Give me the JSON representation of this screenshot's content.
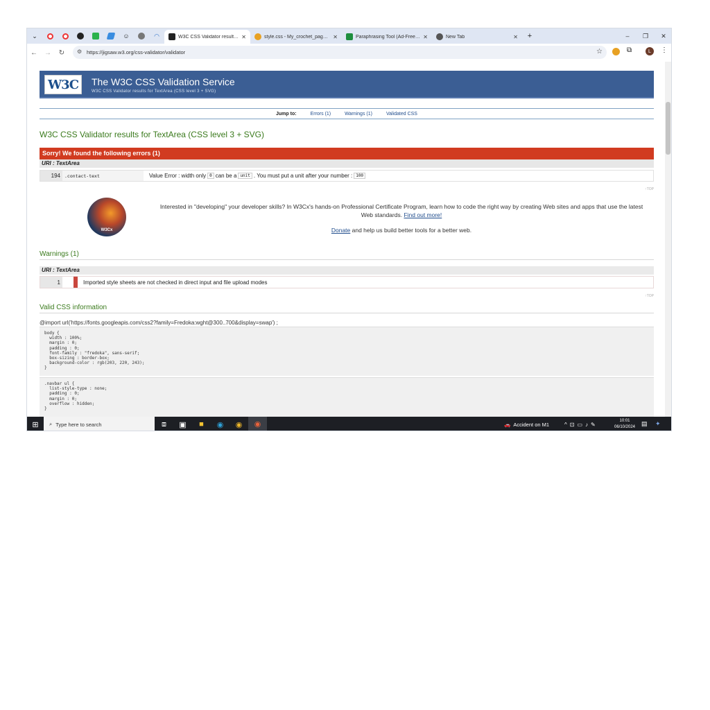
{
  "browser": {
    "tabs": [
      {
        "label": "W3C CSS Validator results for T"
      },
      {
        "label": "style.css - My_crochet_page - G"
      },
      {
        "label": "Paraphrasing Tool (Ad-Free and"
      },
      {
        "label": "New Tab"
      }
    ],
    "url": "https://jigsaw.w3.org/css-validator/validator",
    "avatar_letter": "L"
  },
  "header": {
    "logo_text": "W3C",
    "title": "The W3C CSS Validation Service",
    "subtitle": "W3C CSS Validator results for TextArea (CSS level 3 + SVG)"
  },
  "jump": {
    "label": "Jump to:",
    "errors": "Errors (1)",
    "warnings": "Warnings (1)",
    "validated": "Validated CSS"
  },
  "results_title": "W3C CSS Validator results for TextArea (CSS level 3 + SVG)",
  "errors": {
    "banner": "Sorry! We found the following errors (1)",
    "uri": "URI : TextArea",
    "row": {
      "line": "194",
      "context": ".contact-text",
      "msg_a": "Value Error : width only",
      "code_a": "0",
      "msg_b": "can be a",
      "code_b": "unit",
      "msg_c": ". You must put a unit after your number :",
      "code_c": "100"
    }
  },
  "top_label": "↑TOP",
  "promo": {
    "badge": "W3Cx",
    "text": "Interested in \"developing\" your developer skills? In W3Cx's hands-on Professional Certificate Program, learn how to code the right way by creating Web sites and apps that use the latest Web standards.",
    "link": "Find out more!",
    "donate_link": "Donate",
    "donate_text": " and help us build better tools for a better web."
  },
  "warnings": {
    "heading": "Warnings (1)",
    "uri": "URI : TextArea",
    "row": {
      "line": "1",
      "msg": "Imported style sheets are not checked in direct input and file upload modes"
    }
  },
  "valid": {
    "heading": "Valid CSS information",
    "import": "@import url('https://fonts.googleapis.com/css2?family=Fredoka:wght@300..700&display=swap') ;",
    "blocks": [
      "body {\n  width : 100%;\n  margin : 0;\n  padding : 0;\n  font-family : \"fredoka\", sans-serif;\n  box-sizing : border-box;\n  background-color : rgb(203, 220, 243);\n}",
      ".navbar ul {\n  list-style-type : none;\n  padding : 0;\n  margin : 0;\n  overflow : hidden;\n}"
    ]
  },
  "taskbar": {
    "search_placeholder": "Type here to search",
    "news": "Accident on M1",
    "time": "10:01",
    "date": "06/10/2024"
  }
}
